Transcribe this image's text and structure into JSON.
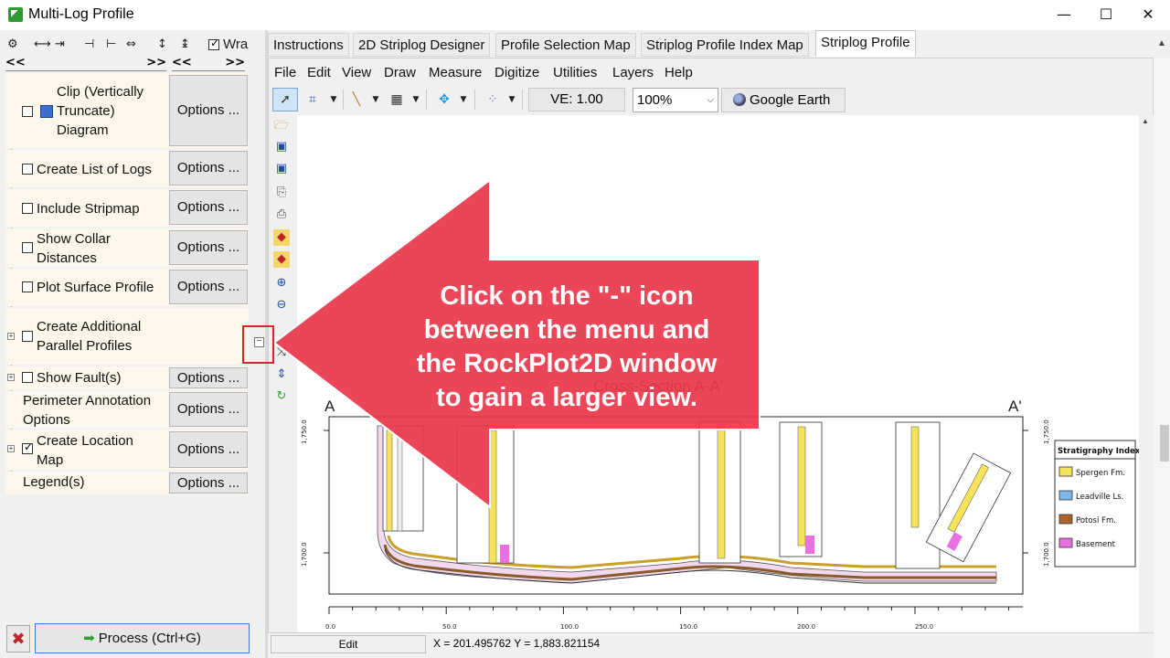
{
  "window": {
    "title": "Multi-Log Profile",
    "minimize": "—",
    "maximize": "☐",
    "close": "✕"
  },
  "left_toolbar": {
    "wrap_label": "Wra",
    "wrap_checked": true
  },
  "collapse_buttons": [
    "<<",
    ">>",
    "<<",
    ">>"
  ],
  "options_items": [
    {
      "label_lines": [
        "Clip (Vertically",
        "Truncate)",
        "Diagram"
      ],
      "checked": false,
      "options_label": "Options ..."
    },
    {
      "label_lines": [
        "Create List of Logs"
      ],
      "checked": false,
      "options_label": "Options ..."
    },
    {
      "label_lines": [
        "Include Stripmap"
      ],
      "checked": false,
      "options_label": "Options ..."
    },
    {
      "label_lines": [
        "Show Collar",
        "Distances"
      ],
      "checked": false,
      "options_label": "Options ..."
    },
    {
      "label_lines": [
        "Plot Surface Profile"
      ],
      "checked": false,
      "options_label": "Options ..."
    },
    {
      "label_lines": [
        "Create Additional",
        "Parallel Profiles"
      ],
      "checked": false,
      "options_label": ""
    },
    {
      "label_lines": [
        "Show Fault(s)"
      ],
      "checked": false,
      "options_label": "Options ..."
    },
    {
      "label_lines": [
        "Perimeter Annotation",
        "Options"
      ],
      "checked": null,
      "options_label": "Options ..."
    },
    {
      "label_lines": [
        "Create Location",
        "Map"
      ],
      "checked": true,
      "options_label": "Options ..."
    },
    {
      "label_lines": [
        "Legend(s)"
      ],
      "checked": null,
      "options_label": "Options ..."
    }
  ],
  "process_button": "Process (Ctrl+G)",
  "tabs": [
    {
      "label": "Instructions",
      "active": false
    },
    {
      "label": "2D Striplog Designer",
      "active": false
    },
    {
      "label": "Profile Selection Map",
      "active": false
    },
    {
      "label": "Striplog Profile Index Map",
      "active": false
    },
    {
      "label": "Striplog Profile",
      "active": true
    }
  ],
  "menu": [
    "File",
    "Edit",
    "View",
    "Draw",
    "Measure",
    "Digitize",
    "Utilities",
    "Layers",
    "Help"
  ],
  "toolbar": {
    "ve_label": "VE: 1.00",
    "zoom_value": "100%",
    "google_earth": "Google Earth"
  },
  "plot": {
    "title": "Cross-Section A-A'",
    "left_end": "A",
    "right_end": "A'",
    "y_ticks": [
      "1,750.0",
      "1,700.0"
    ],
    "x_ticks": [
      "0.0",
      "50.0",
      "100.0",
      "150.0",
      "200.0",
      "250.0"
    ],
    "legend_title": "Stratigraphy Index",
    "legend_items": [
      {
        "label": "Spergen Fm.",
        "color": "#f4e35a"
      },
      {
        "label": "Leadville Ls.",
        "color": "#7db7e8"
      },
      {
        "label": "Potosi Fm.",
        "color": "#a8642c"
      },
      {
        "label": "Basement",
        "color": "#ea6fe0"
      }
    ]
  },
  "status": {
    "mode": "Edit",
    "coords": "X = 201.495762  Y = 1,883.821154"
  },
  "callout": {
    "lines": [
      "Click on the \"-\" icon",
      "between the menu and",
      "the RockPlot2D window",
      "to gain a larger view."
    ],
    "color": "#e8384a"
  },
  "icons": {
    "collapse_panel": "minus-icon"
  }
}
